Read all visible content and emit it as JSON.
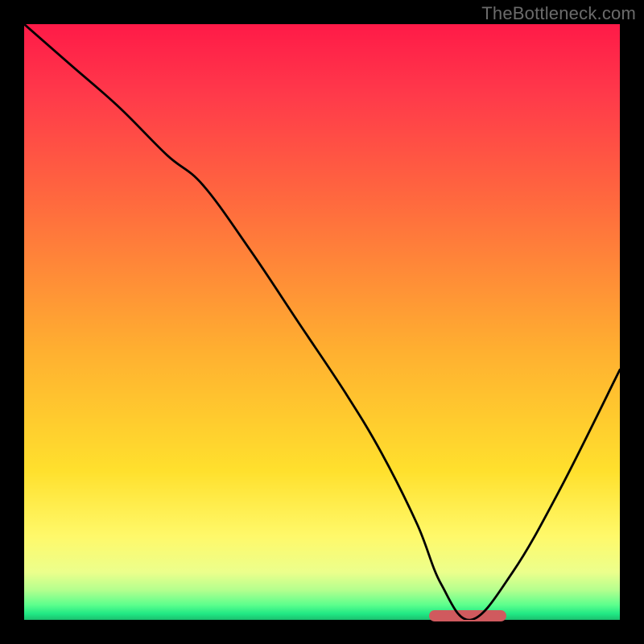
{
  "watermark": "TheBottleneck.com",
  "colors": {
    "page_bg": "#000000",
    "watermark": "#6b6b6b",
    "curve": "#000000",
    "marker": "#d05a5e",
    "gradient_top": "#ff1a48",
    "gradient_bottom": "#1cc06e"
  },
  "chart_data": {
    "type": "line",
    "title": "",
    "xlabel": "",
    "ylabel": "",
    "xlim": [
      0,
      100
    ],
    "ylim": [
      0,
      100
    ],
    "grid": false,
    "series": [
      {
        "name": "bottleneck-curve",
        "x": [
          0,
          8,
          16,
          24,
          30,
          38,
          46,
          54,
          60,
          66,
          70,
          75,
          82,
          90,
          100
        ],
        "y": [
          100,
          93,
          86,
          78,
          73,
          62,
          50,
          38,
          28,
          16,
          6,
          0,
          8,
          22,
          42
        ]
      }
    ],
    "annotations": [
      {
        "name": "optimal-marker",
        "shape": "pill",
        "x_start": 68,
        "x_end": 81,
        "y": 0
      }
    ],
    "notes": "y-values estimated from vertical position against gradient; 0 = bottom (green), 100 = top (red). x-values are fractional horizontal position 0–100."
  }
}
